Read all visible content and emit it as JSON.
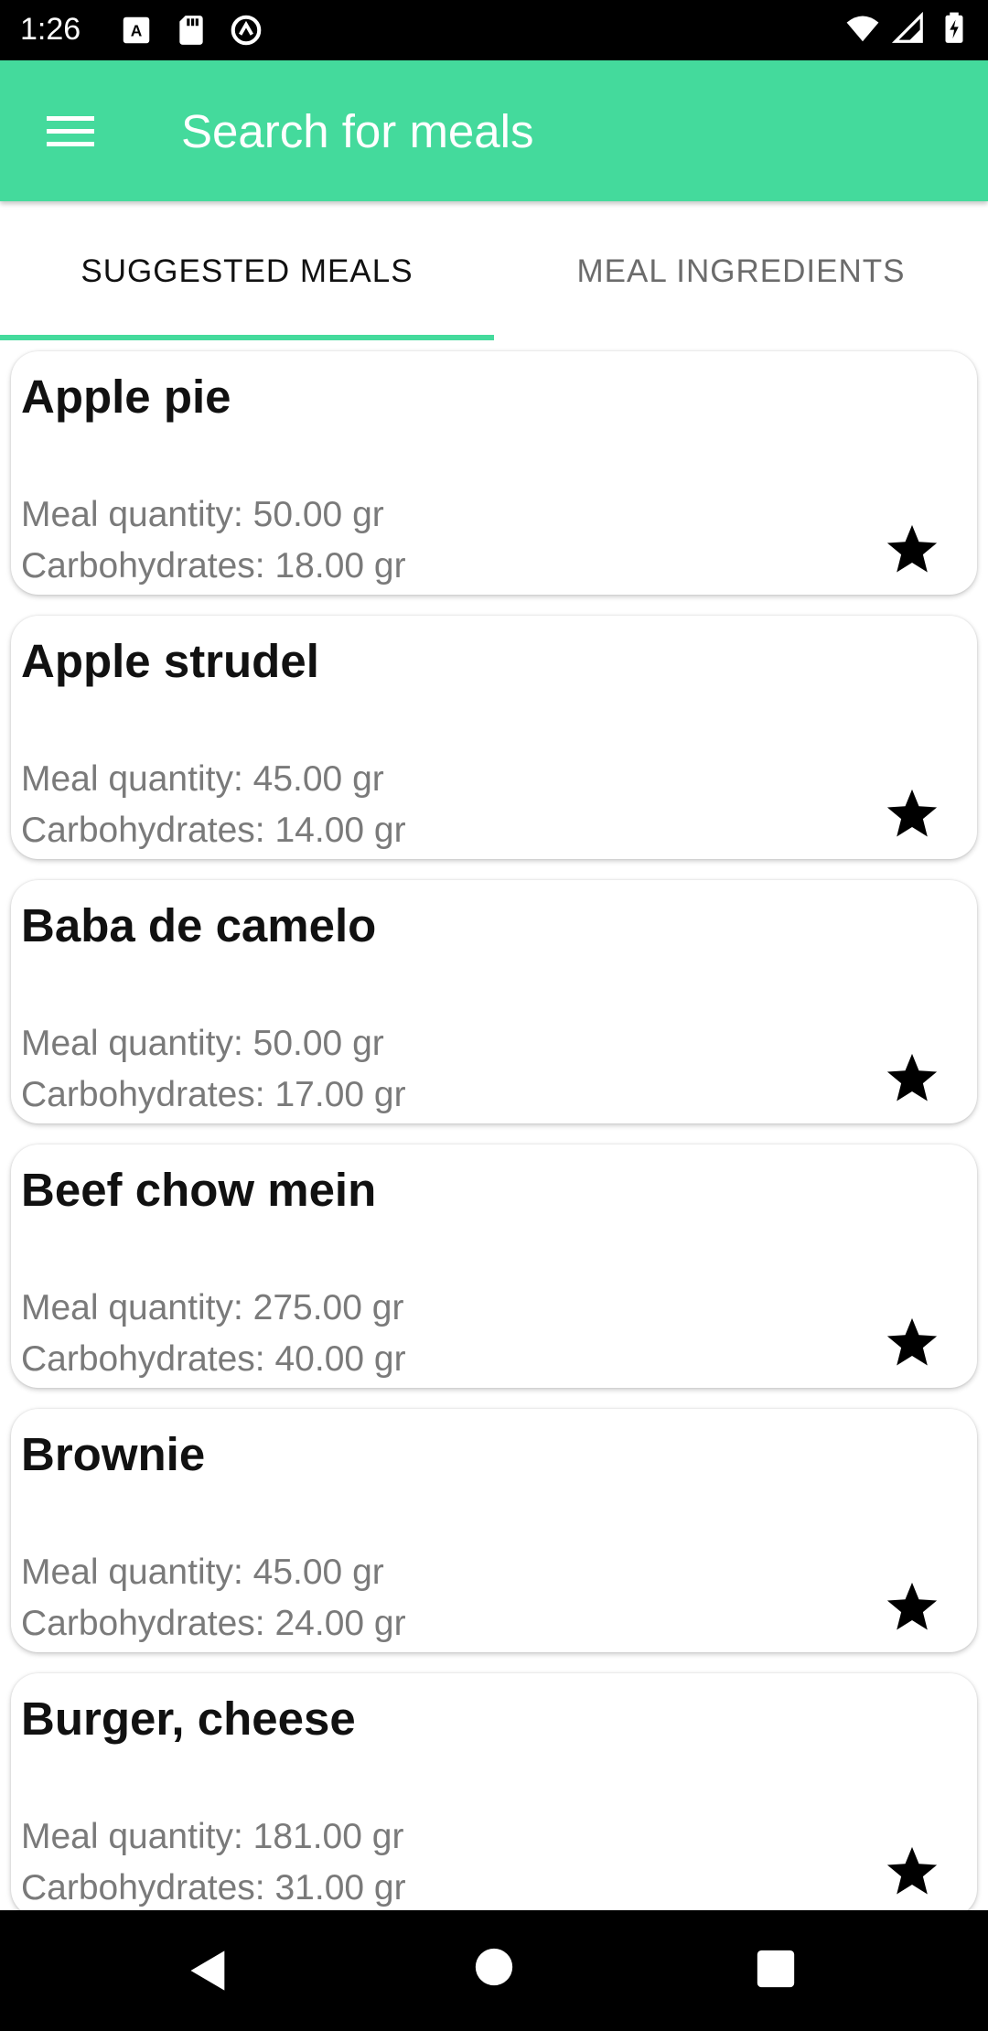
{
  "status_bar": {
    "time": "1:26",
    "left_icons": [
      "text-a-icon",
      "sd-card-icon",
      "no-disturb-icon"
    ],
    "right_icons": [
      "wifi-icon",
      "signal-icon",
      "battery-charging-icon"
    ]
  },
  "app_bar": {
    "menu_icon": "hamburger-menu-icon",
    "title": "Search for meals",
    "color": "#44DA9C"
  },
  "tabs": [
    {
      "label": "SUGGESTED MEALS",
      "selected": true
    },
    {
      "label": "MEAL INGREDIENTS",
      "selected": false
    }
  ],
  "meals": [
    {
      "name": "Apple pie",
      "quantity": "Meal quantity: 50.00 gr",
      "carbs": "Carbohydrates: 18.00 gr"
    },
    {
      "name": "Apple strudel",
      "quantity": "Meal quantity: 45.00 gr",
      "carbs": "Carbohydrates: 14.00 gr"
    },
    {
      "name": "Baba de camelo",
      "quantity": "Meal quantity: 50.00 gr",
      "carbs": "Carbohydrates: 17.00 gr"
    },
    {
      "name": "Beef chow mein",
      "quantity": "Meal quantity: 275.00 gr",
      "carbs": "Carbohydrates: 40.00 gr"
    },
    {
      "name": "Brownie",
      "quantity": "Meal quantity: 45.00 gr",
      "carbs": "Carbohydrates: 24.00 gr"
    },
    {
      "name": "Burger, cheese",
      "quantity": "Meal quantity: 181.00 gr",
      "carbs": "Carbohydrates: 31.00 gr"
    }
  ],
  "nav_bar": {
    "icons": [
      "back-icon",
      "home-icon",
      "recents-icon"
    ]
  }
}
